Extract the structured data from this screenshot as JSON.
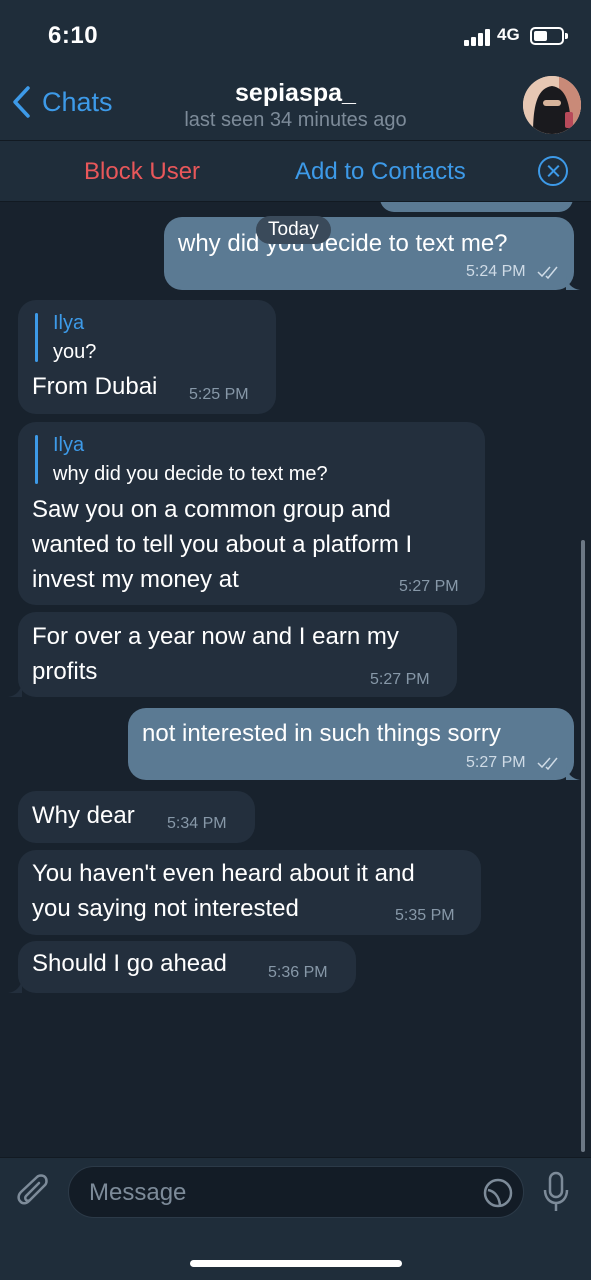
{
  "status_bar": {
    "time": "6:10",
    "network": "4G"
  },
  "header": {
    "back_label": "Chats",
    "title": "sepiaspa_",
    "subtitle": "last seen 34 minutes ago"
  },
  "action_bar": {
    "block_label": "Block User",
    "add_label": "Add to Contacts"
  },
  "date_label": "Today",
  "messages": [
    {
      "dir": "out",
      "text": "why did you decide to text me?",
      "time": "5:24 PM",
      "read": true
    },
    {
      "dir": "in",
      "reply_name": "Ilya",
      "reply_text": "you?",
      "text": "From Dubai",
      "time": "5:25 PM"
    },
    {
      "dir": "in",
      "reply_name": "Ilya",
      "reply_text": "why did you decide to text me?",
      "lines": [
        "Saw you on a common group and",
        "wanted to tell you about a platform I",
        "invest my money at"
      ],
      "time": "5:27 PM"
    },
    {
      "dir": "in",
      "lines": [
        "For over a year now and I earn my",
        "profits"
      ],
      "time": "5:27 PM"
    },
    {
      "dir": "out",
      "text": "not interested in such things sorry",
      "time": "5:27 PM",
      "read": true
    },
    {
      "dir": "in",
      "text": "Why dear",
      "time": "5:34 PM"
    },
    {
      "dir": "in",
      "lines": [
        "You haven't even heard about it and",
        "you saying not interested"
      ],
      "time": "5:35 PM"
    },
    {
      "dir": "in",
      "text": "Should I go ahead",
      "time": "5:36 PM"
    }
  ],
  "input": {
    "placeholder": "Message"
  },
  "colors": {
    "accent": "#3d9ae8",
    "danger": "#e8575a",
    "outgoing": "#5b7a93",
    "incoming": "#232f3d",
    "background": "#18222d"
  },
  "icons": [
    "chevron-left-icon",
    "close-icon",
    "double-check-icon",
    "paperclip-icon",
    "sticker-icon",
    "microphone-icon"
  ]
}
